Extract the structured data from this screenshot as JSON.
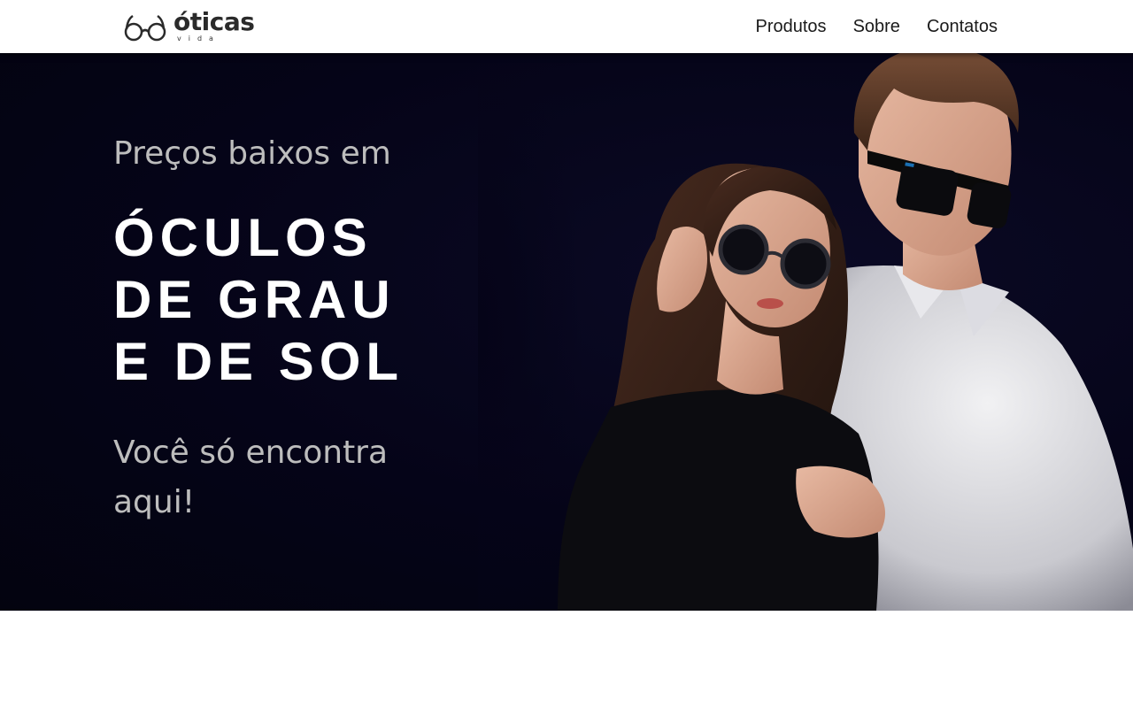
{
  "header": {
    "logo": {
      "word": "óticas",
      "sub": "vida"
    },
    "nav": [
      {
        "label": "Produtos"
      },
      {
        "label": "Sobre"
      },
      {
        "label": "Contatos"
      }
    ]
  },
  "hero": {
    "intro": "Preços baixos em",
    "headline": [
      "ÓCULOS",
      "DE GRAU",
      "E DE SOL"
    ],
    "outro": "Você só encontra aqui!"
  },
  "colors": {
    "hero_background": "#050418",
    "headline": "#ffffff",
    "subtext": "#bdbdbd",
    "nav_text": "#1a1a1a"
  },
  "icons": {
    "logo_mark": "glasses-icon",
    "hero_image": "couple-sunglasses-photo"
  }
}
